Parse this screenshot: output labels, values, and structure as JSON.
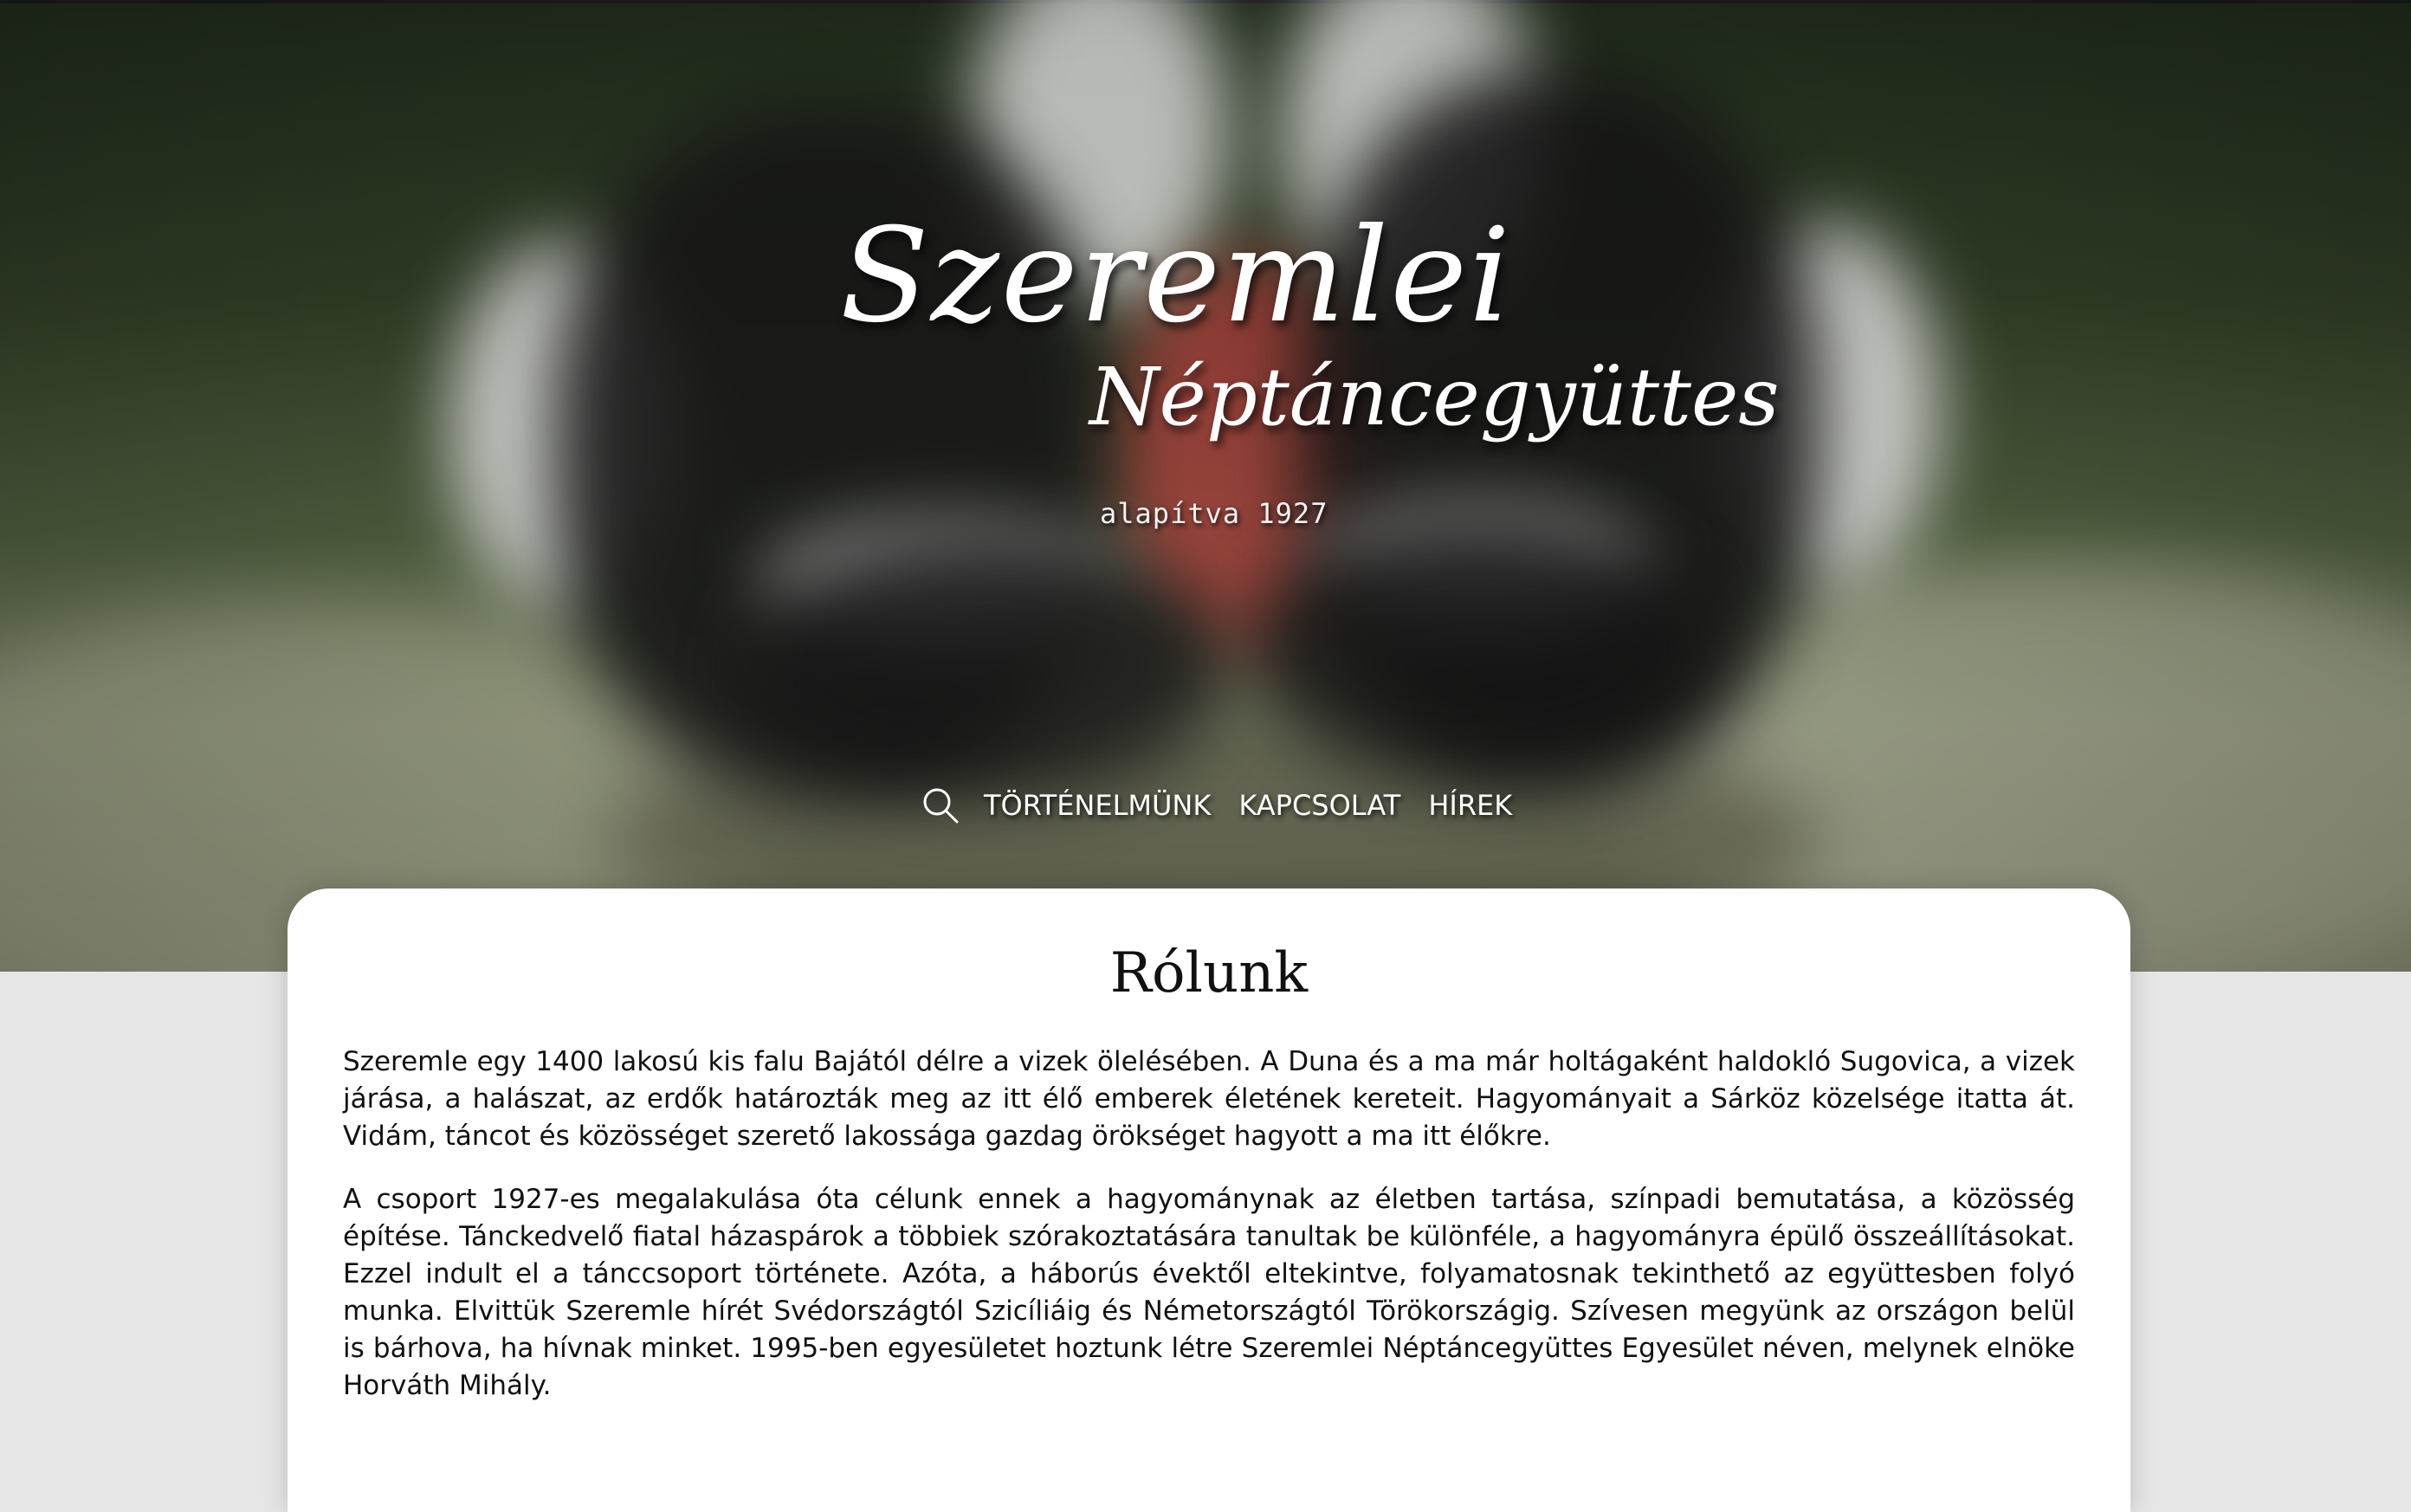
{
  "site": {
    "title_line1": "Szeremlei",
    "title_line2": "Néptáncegyüttes",
    "subtitle": "alapítva 1927"
  },
  "nav": {
    "search_icon": "search-icon",
    "items": [
      {
        "label": "TÖRTÉNELMÜNK"
      },
      {
        "label": "KAPCSOLAT"
      },
      {
        "label": "HÍREK"
      }
    ]
  },
  "about": {
    "heading": "Rólunk",
    "paragraphs": [
      "Szeremle egy 1400 lakosú kis falu Bajától délre a vizek ölelésében. A Duna és a ma már holtágaként haldokló Sugovica, a vizek járása, a halászat, az erdők határozták meg az itt élő emberek életének kereteit. Hagyományait a Sárköz közelsége itatta át. Vidám, táncot és közösséget szerető lakossága gazdag örökséget hagyott a ma itt élőkre.",
      "A csoport 1927-es megalakulása óta célunk ennek a hagyománynak az életben tartása, színpadi bemutatása, a közösség építése. Tánckedvelő fiatal házaspárok a többiek szórakoztatására tanultak be különféle, a hagyományra épülő összeállításokat. Ezzel indult el a tánccsoport története. Azóta, a háborús évektől eltekintve, folyamatosnak tekinthető az együttesben folyó munka. Elvittük Szeremle hírét Svédországtól Szicíliáig és Németországtól Törökországig. Szívesen megyünk az országon belül is bárhova, ha hívnak minket. 1995-ben egyesületet hoztunk létre Szeremlei Néptáncegyüttes Egyesület néven, melynek elnöke Horváth Mihály."
    ]
  },
  "colors": {
    "page_background": "#e6e6e6",
    "card_background": "#ffffff",
    "text": "#111111",
    "hero_text": "#ffffff"
  }
}
